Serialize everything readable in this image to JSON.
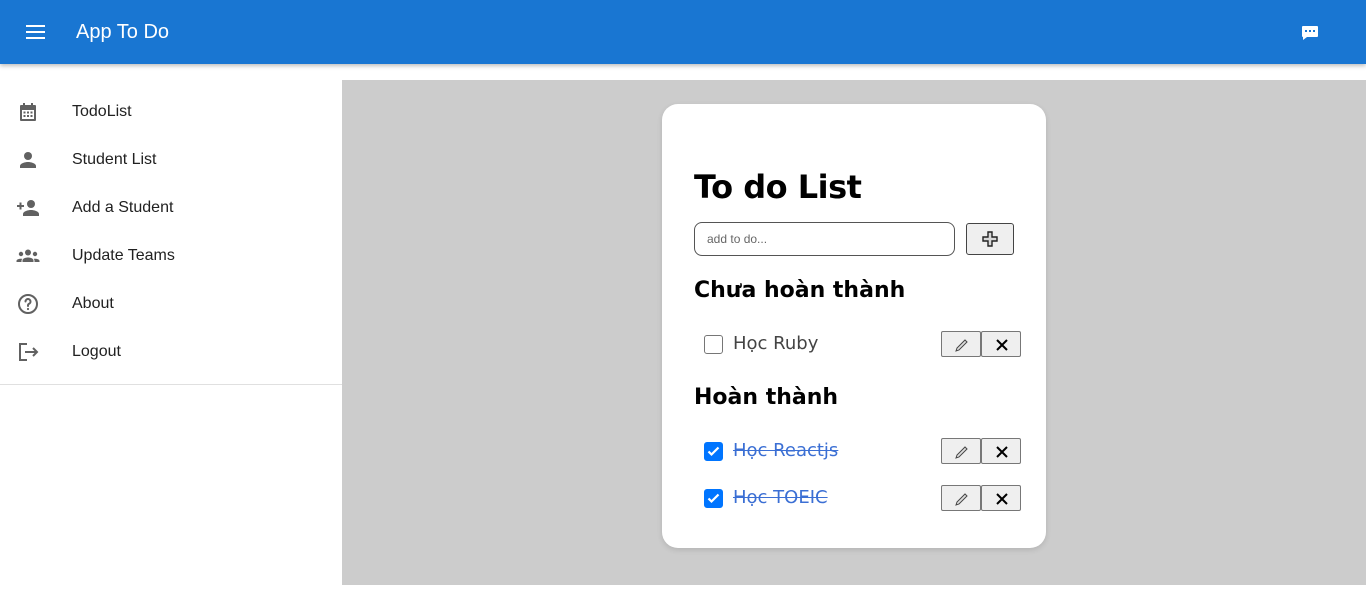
{
  "appbar": {
    "title": "App To Do",
    "menu_icon": "menu-icon",
    "chat_icon": "chat-icon",
    "color": "#1976d2"
  },
  "sidebar": {
    "items": [
      {
        "label": "TodoList",
        "icon": "calendar-icon"
      },
      {
        "label": "Student List",
        "icon": "person-icon"
      },
      {
        "label": "Add a Student",
        "icon": "person-add-icon"
      },
      {
        "label": "Update Teams",
        "icon": "groups-icon"
      },
      {
        "label": "About",
        "icon": "help-circle-icon"
      },
      {
        "label": "Logout",
        "icon": "logout-icon"
      }
    ]
  },
  "card": {
    "title": "To do List",
    "input_placeholder": "add to do...",
    "input_value": "",
    "add_icon": "plus-icon",
    "incomplete_heading": "Chưa hoàn thành",
    "complete_heading": "Hoàn thành",
    "incomplete": [
      {
        "text": "Học Ruby",
        "checked": false
      }
    ],
    "complete": [
      {
        "text": "Học Reactjs",
        "checked": true
      },
      {
        "text": "Học TOEIC",
        "checked": true
      }
    ],
    "edit_icon": "pencil-icon",
    "delete_icon": "close-icon"
  },
  "colors": {
    "main_background": "#cccccc",
    "checkbox_checked": "#0075ff",
    "done_text": "#3b6fd4"
  }
}
